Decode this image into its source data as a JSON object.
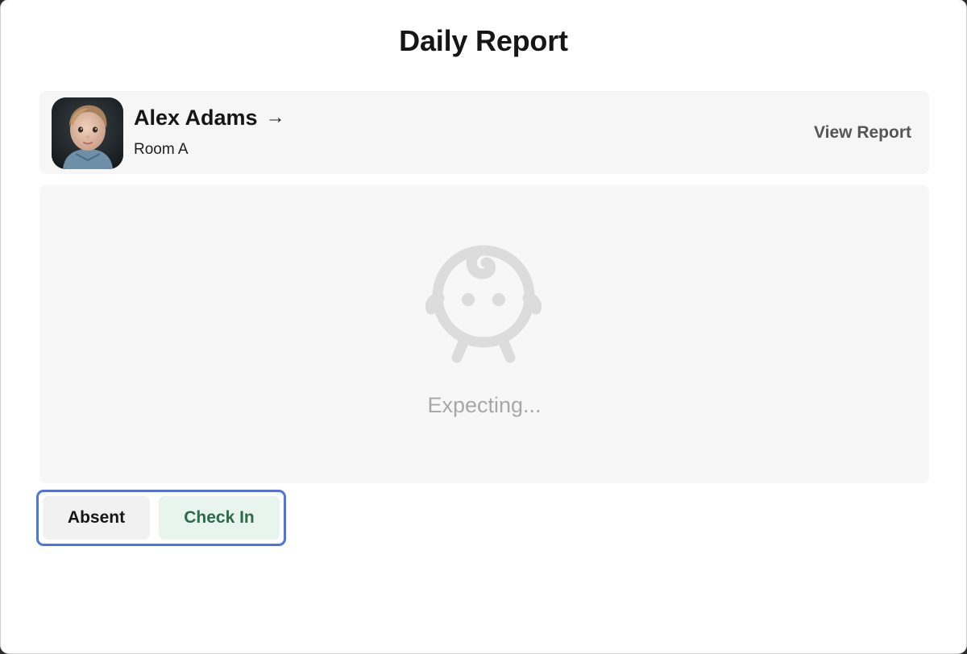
{
  "modal": {
    "title": "Daily Report"
  },
  "child": {
    "name": "Alex Adams",
    "arrow_icon": "→",
    "room": "Room A",
    "view_report_label": "View Report",
    "avatar_icon": "child-photo"
  },
  "status": {
    "icon": "baby-icon",
    "text": "Expecting..."
  },
  "actions": {
    "absent_label": "Absent",
    "check_in_label": "Check In"
  },
  "colors": {
    "focus_ring": "#4d74e0",
    "check_in_bg": "#e8f5ee",
    "check_in_text": "#2d6a49",
    "placeholder_icon": "#dcdcdc"
  }
}
